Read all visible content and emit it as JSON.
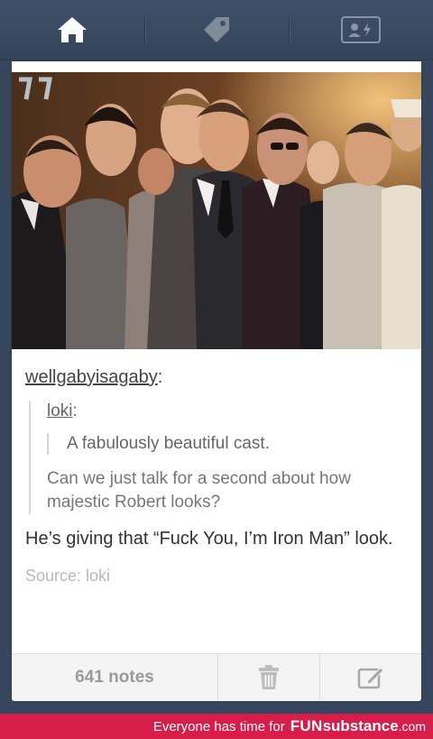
{
  "nav": {
    "items": [
      {
        "name": "home",
        "icon": "home-icon"
      },
      {
        "name": "tags",
        "icon": "tag-icon"
      },
      {
        "name": "account",
        "icon": "account-card-icon"
      }
    ]
  },
  "post": {
    "author": "wellgabyisagaby",
    "author_suffix": ":",
    "quote": {
      "author": "loki",
      "author_suffix": ":",
      "text": "A fabulously beautiful cast.",
      "reply": "Can we just talk for a second about how majestic Robert looks?"
    },
    "body": "He’s giving that “Fuck You, I’m Iron Man” look.",
    "source_label": "Source: loki",
    "notes": "641 notes"
  },
  "footer": {
    "actions": [
      {
        "name": "delete",
        "icon": "trash-icon"
      },
      {
        "name": "edit",
        "icon": "edit-icon"
      }
    ]
  },
  "watermark": {
    "tagline": "Everyone has time for",
    "brand_a": "FUN",
    "brand_b": "substance",
    "domain": ".com"
  },
  "colors": {
    "nav_bg": "#36465d",
    "banner": "#d81d4b",
    "card": "#ffffff"
  }
}
